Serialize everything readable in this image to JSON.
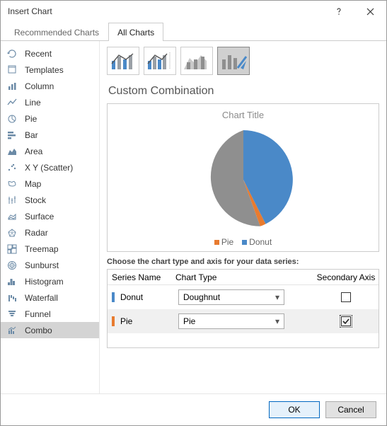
{
  "window": {
    "title": "Insert Chart"
  },
  "tabs": {
    "recommended": "Recommended Charts",
    "all": "All Charts"
  },
  "sidebar": {
    "items": [
      {
        "label": "Recent"
      },
      {
        "label": "Templates"
      },
      {
        "label": "Column"
      },
      {
        "label": "Line"
      },
      {
        "label": "Pie"
      },
      {
        "label": "Bar"
      },
      {
        "label": "Area"
      },
      {
        "label": "X Y (Scatter)"
      },
      {
        "label": "Map"
      },
      {
        "label": "Stock"
      },
      {
        "label": "Surface"
      },
      {
        "label": "Radar"
      },
      {
        "label": "Treemap"
      },
      {
        "label": "Sunburst"
      },
      {
        "label": "Histogram"
      },
      {
        "label": "Waterfall"
      },
      {
        "label": "Funnel"
      },
      {
        "label": "Combo"
      }
    ]
  },
  "main": {
    "section_title": "Custom Combination",
    "preview": {
      "title": "Chart Title",
      "legend": {
        "pie": "Pie",
        "donut": "Donut"
      }
    },
    "series_hint": "Choose the chart type and axis for your data series:",
    "grid": {
      "head": {
        "series": "Series Name",
        "type": "Chart Type",
        "axis": "Secondary Axis"
      },
      "rows": [
        {
          "name": "Donut",
          "type": "Doughnut",
          "secondary": false,
          "swatch": "#4a89c8"
        },
        {
          "name": "Pie",
          "type": "Pie",
          "secondary": true,
          "swatch": "#e87b2f"
        }
      ]
    }
  },
  "footer": {
    "ok": "OK",
    "cancel": "Cancel"
  },
  "colors": {
    "blue": "#4a89c8",
    "gray": "#8f8f8f",
    "orange": "#e87b2f"
  },
  "chart_data": {
    "type": "pie",
    "title": "Chart Title",
    "series": [
      {
        "name": "Donut",
        "color": "#4a89c8",
        "value": 35
      },
      {
        "name": "Pie (gray)",
        "color": "#8f8f8f",
        "value": 63
      },
      {
        "name": "Pie (orange)",
        "color": "#e87b2f",
        "value": 2
      }
    ],
    "legend": [
      "Pie",
      "Donut"
    ]
  }
}
